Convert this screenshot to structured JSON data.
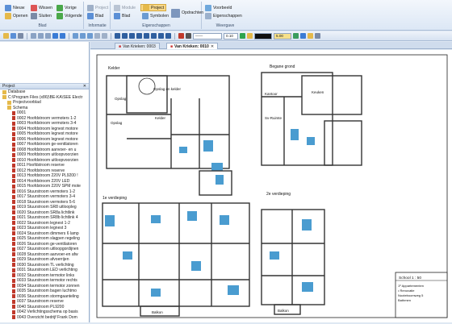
{
  "ribbon": {
    "blad": {
      "label": "Blad",
      "nieuw": "Nieuw",
      "wissen": "Wissen",
      "vorige": "Vorige",
      "openen": "Openen",
      "sluiten": "Sluiten",
      "volgende": "Volgende"
    },
    "informatie": {
      "label": "Informatie",
      "project": "Project",
      "blad": "Blad"
    },
    "eigenschappen": {
      "label": "Eigenschappen",
      "module": "Module",
      "project": "Project",
      "symbolen": "Symbolen",
      "opdrachten": "Opdrachten"
    },
    "weergave": {
      "label": "Weergave",
      "voorbeeld": "Voorbeeld",
      "eigenschappen": "Eigenschappen"
    }
  },
  "toolbar": {
    "line_width": "0.10",
    "zoom": "5.00"
  },
  "panel": {
    "header": "Project",
    "tree": [
      {
        "text": "Database",
        "level": 0
      },
      {
        "text": "C:\\Program Files (x86)\\BE-KA\\SEE Electr",
        "level": 0
      },
      {
        "text": "Projectvoorblad",
        "level": 1
      },
      {
        "text": "Schema",
        "level": 1
      },
      {
        "text": "0001",
        "level": 2
      },
      {
        "text": "0002 Hoofdstroom vermoters 1-2",
        "level": 2
      },
      {
        "text": "0003 Hoofdstroom vermoters 3-4",
        "level": 2
      },
      {
        "text": "0004 Hoofdstroom legnest motore",
        "level": 2
      },
      {
        "text": "0005 Hoofdstroom legnest motore",
        "level": 2
      },
      {
        "text": "0006 Hoofdstroom legnest motore",
        "level": 2
      },
      {
        "text": "0007 Hoofdstroom ge-ventilatoren",
        "level": 2
      },
      {
        "text": "0008 Hoofdstroom aanvoer- en u",
        "level": 2
      },
      {
        "text": "0009 Hoofdstroom uitloopvoorzien",
        "level": 2
      },
      {
        "text": "0010 Hoofdstroom uitloopvoorzien",
        "level": 2
      },
      {
        "text": "0011 Hoofdstroom reserve",
        "level": 2
      },
      {
        "text": "0012 Hoofdstroom reserve",
        "level": 2
      },
      {
        "text": "0013 Hoofdstroom 220V PL9200 !",
        "level": 2
      },
      {
        "text": "0014 Hoofdstroom 220V LED",
        "level": 2
      },
      {
        "text": "0015 Hoofdstroom 220V SPM mote",
        "level": 2
      },
      {
        "text": "0016 Stuurstroom vermoters 1-2",
        "level": 2
      },
      {
        "text": "0017 Stuurstroom vermoters 3-4",
        "level": 2
      },
      {
        "text": "0018 Stuurstroom vermoters 5-6",
        "level": 2
      },
      {
        "text": "0019 Stuurstroom SR8 uitloopleg",
        "level": 2
      },
      {
        "text": "0020 Stuurstroom SR8a lichtlink",
        "level": 2
      },
      {
        "text": "0021 Stuurstroom SR8b lichtlink 4",
        "level": 2
      },
      {
        "text": "0022 Stuurstroom legnest 1-2",
        "level": 2
      },
      {
        "text": "0023 Stuurstroom legnest 3",
        "level": 2
      },
      {
        "text": "0024 Stuurstroom dimmers 6 lamp",
        "level": 2
      },
      {
        "text": "0025 Stuurstroom slagpen regeling",
        "level": 2
      },
      {
        "text": "0026 Stuurstroom ge-ventilatoren",
        "level": 2
      },
      {
        "text": "0027 Stuurstroom uitloopgordijnen",
        "level": 2
      },
      {
        "text": "0028 Stuurstroom aanvoer-en afw",
        "level": 2
      },
      {
        "text": "0029 Stuurstroom afvoerrijen",
        "level": 2
      },
      {
        "text": "0030 Stuurstroom TL verlichting",
        "level": 2
      },
      {
        "text": "0031 Stuurstroom LED verlichting",
        "level": 2
      },
      {
        "text": "0032 Stuurstroom termotor links",
        "level": 2
      },
      {
        "text": "0033 Stuurstroom termotor rechts",
        "level": 2
      },
      {
        "text": "0034 Stuurstroom termotor zonnen",
        "level": 2
      },
      {
        "text": "0035 Stuurstroom bagen luchtmo",
        "level": 2
      },
      {
        "text": "0036 Stuurstroom stormgaanteling",
        "level": 2
      },
      {
        "text": "0037 Stuurstroom reserve",
        "level": 2
      },
      {
        "text": "0040 Stuurstroom PL9200",
        "level": 2
      },
      {
        "text": "0042 Verlichtingsschema op basis",
        "level": 2
      },
      {
        "text": "0043 Overzicht bedrijf Frank Dom",
        "level": 2
      }
    ]
  },
  "tabs": [
    {
      "label": "Van Krieken: 0003"
    },
    {
      "label": "Van Krieken: 0010"
    }
  ],
  "drawing": {
    "kelder": "Kelder",
    "begane_grond": "Begane grond",
    "verdieping1": "1e verdieping",
    "verdieping2": "2e verdieping",
    "opslag": "Opslag",
    "opslag_en_kelder": "Opslag en kelder",
    "kelder_room": "Kelder",
    "kantoor": "Kantoor",
    "keuken": "Keuken",
    "sv_ruimte": "Sv-Ruimte",
    "badkamer": "Badkamer",
    "slpk": "Slpk",
    "balkon": "Balkon",
    "title_school": "School 1 : 50",
    "title_lines": [
      "1º Appartementen",
      "• Renovatie",
      "Nooteboomweg 5",
      "Bathmen"
    ]
  },
  "colors": {
    "accent": "#4a9cd0",
    "wall": "#333333"
  }
}
